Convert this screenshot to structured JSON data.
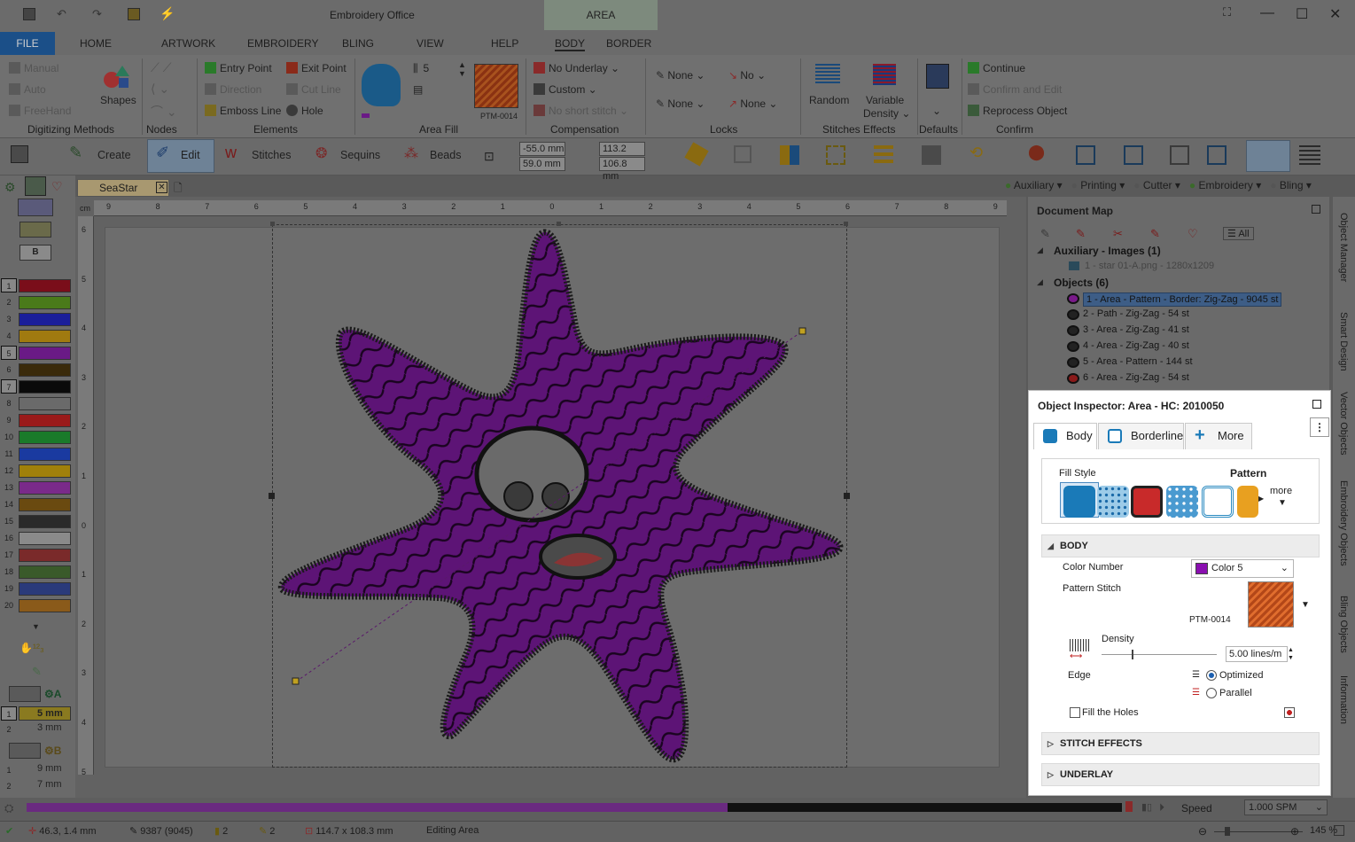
{
  "app": {
    "title": "Embroidery Office",
    "context_tab": "AREA"
  },
  "ribbon_tabs": [
    "HOME",
    "ARTWORK",
    "EMBROIDERY",
    "BLING",
    "VIEW",
    "HELP",
    "BODY",
    "BORDER"
  ],
  "file_tab": "FILE",
  "ribbon": {
    "digitizing": {
      "manual": "Manual",
      "auto": "Auto",
      "freehand": "FreeHand",
      "shapes": "Shapes",
      "group": "Digitizing Methods"
    },
    "nodes": {
      "group": "Nodes"
    },
    "elements": {
      "entry_point": "Entry Point",
      "exit_point": "Exit Point",
      "direction": "Direction",
      "cut_line": "Cut Line",
      "emboss_line": "Emboss Line",
      "hole": "Hole",
      "group": "Elements"
    },
    "area_fill": {
      "count": "5",
      "pattern": "PTM-0014",
      "group": "Area Fill"
    },
    "compensation": {
      "no_underlay": "No Underlay",
      "custom": "Custom",
      "no_short_stitch": "No short stitch",
      "group": "Compensation"
    },
    "locks": {
      "none1": "None",
      "no": "No",
      "none2": "None",
      "none3": "None",
      "group": "Locks"
    },
    "stitches_effects": {
      "random": "Random",
      "variable": "Variable",
      "density": "Density",
      "group": "Stitches Effects"
    },
    "defaults": {
      "group": "Defaults"
    },
    "confirm": {
      "continue": "Continue",
      "confirm_edit": "Confirm and Edit",
      "reprocess": "Reprocess Object",
      "group": "Confirm"
    }
  },
  "toolbar": {
    "create": "Create",
    "edit": "Edit",
    "stitches": "Stitches",
    "sequins": "Sequins",
    "beads": "Beads",
    "x": "-55.0 mm",
    "y": "59.0 mm",
    "w": "113.2 mm",
    "h": "106.8 mm"
  },
  "outputs": [
    "Auxiliary",
    "Printing",
    "Cutter",
    "Embroidery",
    "Bling"
  ],
  "document_tab": "SeaStar",
  "ruler": {
    "unit": "cm",
    "h_ticks": [
      "9",
      "8",
      "7",
      "6",
      "5",
      "4",
      "3",
      "2",
      "1",
      "0",
      "1",
      "2",
      "3",
      "4",
      "5",
      "6",
      "7",
      "8",
      "9"
    ],
    "v_ticks": [
      "6",
      "5",
      "4",
      "3",
      "2",
      "1",
      "0",
      "1",
      "2",
      "3",
      "4",
      "5"
    ]
  },
  "palette": {
    "numbers": [
      "1",
      "2",
      "3",
      "4",
      "5",
      "6",
      "7",
      "8",
      "9",
      "10",
      "11",
      "12",
      "13",
      "14",
      "15",
      "16",
      "17",
      "18",
      "19",
      "20"
    ],
    "colors": [
      "#7a0e1a",
      "#4a7a1a",
      "#1a1e9a",
      "#a07a10",
      "#6a1a86",
      "#3a2a0a",
      "#0a0a0a",
      "#6a6a6a",
      "#9a1a1a",
      "#1a7a2a",
      "#1a3aa0",
      "#a0800a",
      "#7a2a8a",
      "#6a4a10",
      "#2a2a2a",
      "#8a8a8a",
      "#7a2a2a",
      "#3a5a2a",
      "#2a3a7a",
      "#8a5a1a"
    ],
    "selected": [
      "1",
      "5",
      "7"
    ],
    "b_label": "B",
    "a_label": "A",
    "sizes_a": [
      {
        "n": "1",
        "v": "5 mm"
      },
      {
        "n": "2",
        "v": "3 mm"
      }
    ],
    "b2_label": "B",
    "sizes_b": [
      {
        "n": "1",
        "v": "9 mm"
      },
      {
        "n": "2",
        "v": "7 mm"
      }
    ]
  },
  "document_map": {
    "title": "Document Map",
    "filter_all": "All",
    "auxiliary_header": "Auxiliary - Images (1)",
    "auxiliary_item": "1 - star 01-A.png - 1280x1209",
    "objects_header": "Objects (6)",
    "objects": [
      "1 - Area - Pattern - Border: Zig-Zag - 9045 st",
      "2 - Path - Zig-Zag - 54 st",
      "3 - Area - Zig-Zag - 41 st",
      "4 - Area - Zig-Zag - 40 st",
      "5 - Area - Pattern - 144 st",
      "6 - Area - Zig-Zag - 54 st"
    ]
  },
  "inspector": {
    "title": "Object Inspector: Area - HC: 2010050",
    "tabs": [
      "Body",
      "Borderline",
      "More"
    ],
    "fill_style_label": "Fill Style",
    "fill_style_value": "Pattern",
    "more": "more",
    "body_section": "BODY",
    "color_number_label": "Color Number",
    "color_value": "Color 5",
    "pattern_stitch_label": "Pattern Stitch",
    "pattern_code": "PTM-0014",
    "density_label": "Density",
    "density_value": "5.00 lines/m",
    "edge_label": "Edge",
    "edge_options": [
      "Optimized",
      "Parallel"
    ],
    "edge_selected": "Optimized",
    "fill_holes_label": "Fill the Holes",
    "stitch_effects": "STITCH EFFECTS",
    "underlay": "UNDERLAY"
  },
  "side_tabs": [
    "Object Manager",
    "Smart Design",
    "Vector Objects",
    "Embroidery Objects",
    "Bling Objects",
    "Information"
  ],
  "simulation": {
    "speed_label": "Speed",
    "speed_value": "1.000 SPM",
    "progress": 0.64
  },
  "status": {
    "coords": "46.3, 1.4 mm",
    "stitches": "9387 (9045)",
    "colors": "2",
    "objects": "2",
    "size": "114.7 x 108.3 mm",
    "mode": "Editing Area",
    "zoom": "145 %"
  }
}
